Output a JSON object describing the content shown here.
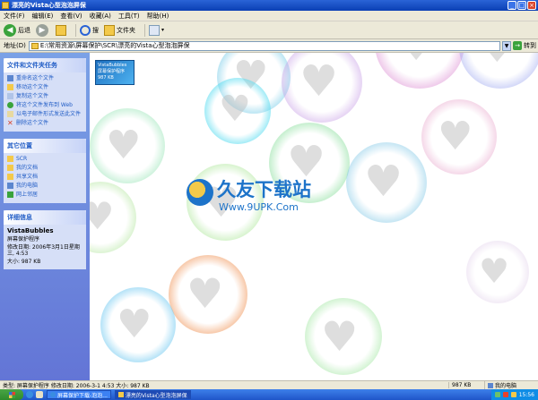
{
  "window": {
    "title": "漂亮的Vista心型泡泡屏保",
    "buttons": {
      "minimize": "_",
      "maximize": "□",
      "close": "×"
    }
  },
  "menu": [
    "文件(F)",
    "编辑(E)",
    "查看(V)",
    "收藏(A)",
    "工具(T)",
    "帮助(H)"
  ],
  "toolbar": {
    "back_label": "后退",
    "search_label": "搜",
    "folders_label": "文件夹"
  },
  "address": {
    "label": "地址(D)",
    "value": "E:\\常用资源\\屏幕保护\\SCR\\漂亮的Vista心型泡泡屏保",
    "go_label": "转到"
  },
  "tasks": {
    "header": "文件和文件夹任务",
    "items": [
      "重命名这个文件",
      "移动这个文件",
      "复制这个文件",
      "将这个文件发布到 Web",
      "以电子邮件形式发送此文件",
      "删除这个文件"
    ]
  },
  "other_places": {
    "header": "其它位置",
    "items": [
      "SCR",
      "我的文档",
      "共享文档",
      "我的电脑",
      "网上邻居"
    ]
  },
  "details": {
    "header": "详细信息",
    "name": "VistaBubbles",
    "type": "屏幕保护程序",
    "modified": "修改日期: 2006年3月1日星期三, 4:53",
    "size": "大小: 987 KB"
  },
  "file": {
    "thumb_text": "VistaBubbles 屏幕保护程序 987 KB"
  },
  "watermark": {
    "title": "久友下载站",
    "url": "Www.9UPK.Com"
  },
  "status": {
    "main": "类型: 屏幕保护程序 修改日期: 2006-3-1 4:53 大小: 987 KB",
    "size": "987 KB",
    "zone": "我的电脑"
  },
  "taskbar": {
    "tasks": [
      "屏幕保护下载-泡泡...",
      "漂亮的Vista心型泡泡屏保"
    ],
    "clock": "15:56"
  },
  "colors": {
    "xp_blue": "#0a3fb4",
    "pane_blue": "#6375d6",
    "logo_blue": "#1d73c9",
    "start_green": "#3aa33c"
  }
}
